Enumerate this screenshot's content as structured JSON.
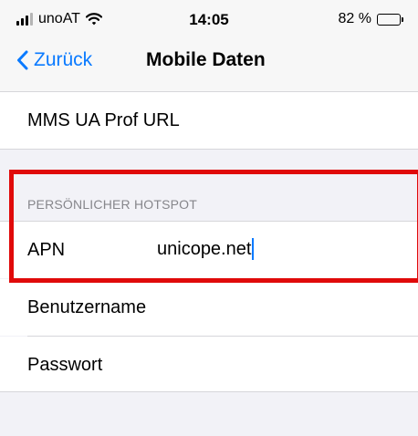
{
  "status_bar": {
    "carrier": "unoAT",
    "time": "14:05",
    "battery_text": "82 %",
    "battery_level": 0.82
  },
  "nav": {
    "back_label": "Zurück",
    "title": "Mobile Daten"
  },
  "mms": {
    "label": "MMS UA Prof URL"
  },
  "hotspot": {
    "header": "PERSÖNLICHER HOTSPOT",
    "apn_label": "APN",
    "apn_value": "unicope.net",
    "username_label": "Benutzername",
    "password_label": "Passwort"
  },
  "colors": {
    "accent": "#0a7aff",
    "highlight": "#e00a0a",
    "group_background": "#f2f2f7"
  },
  "icons": [
    "signal-icon",
    "wifi-icon",
    "battery-icon",
    "chevron-left-icon"
  ]
}
